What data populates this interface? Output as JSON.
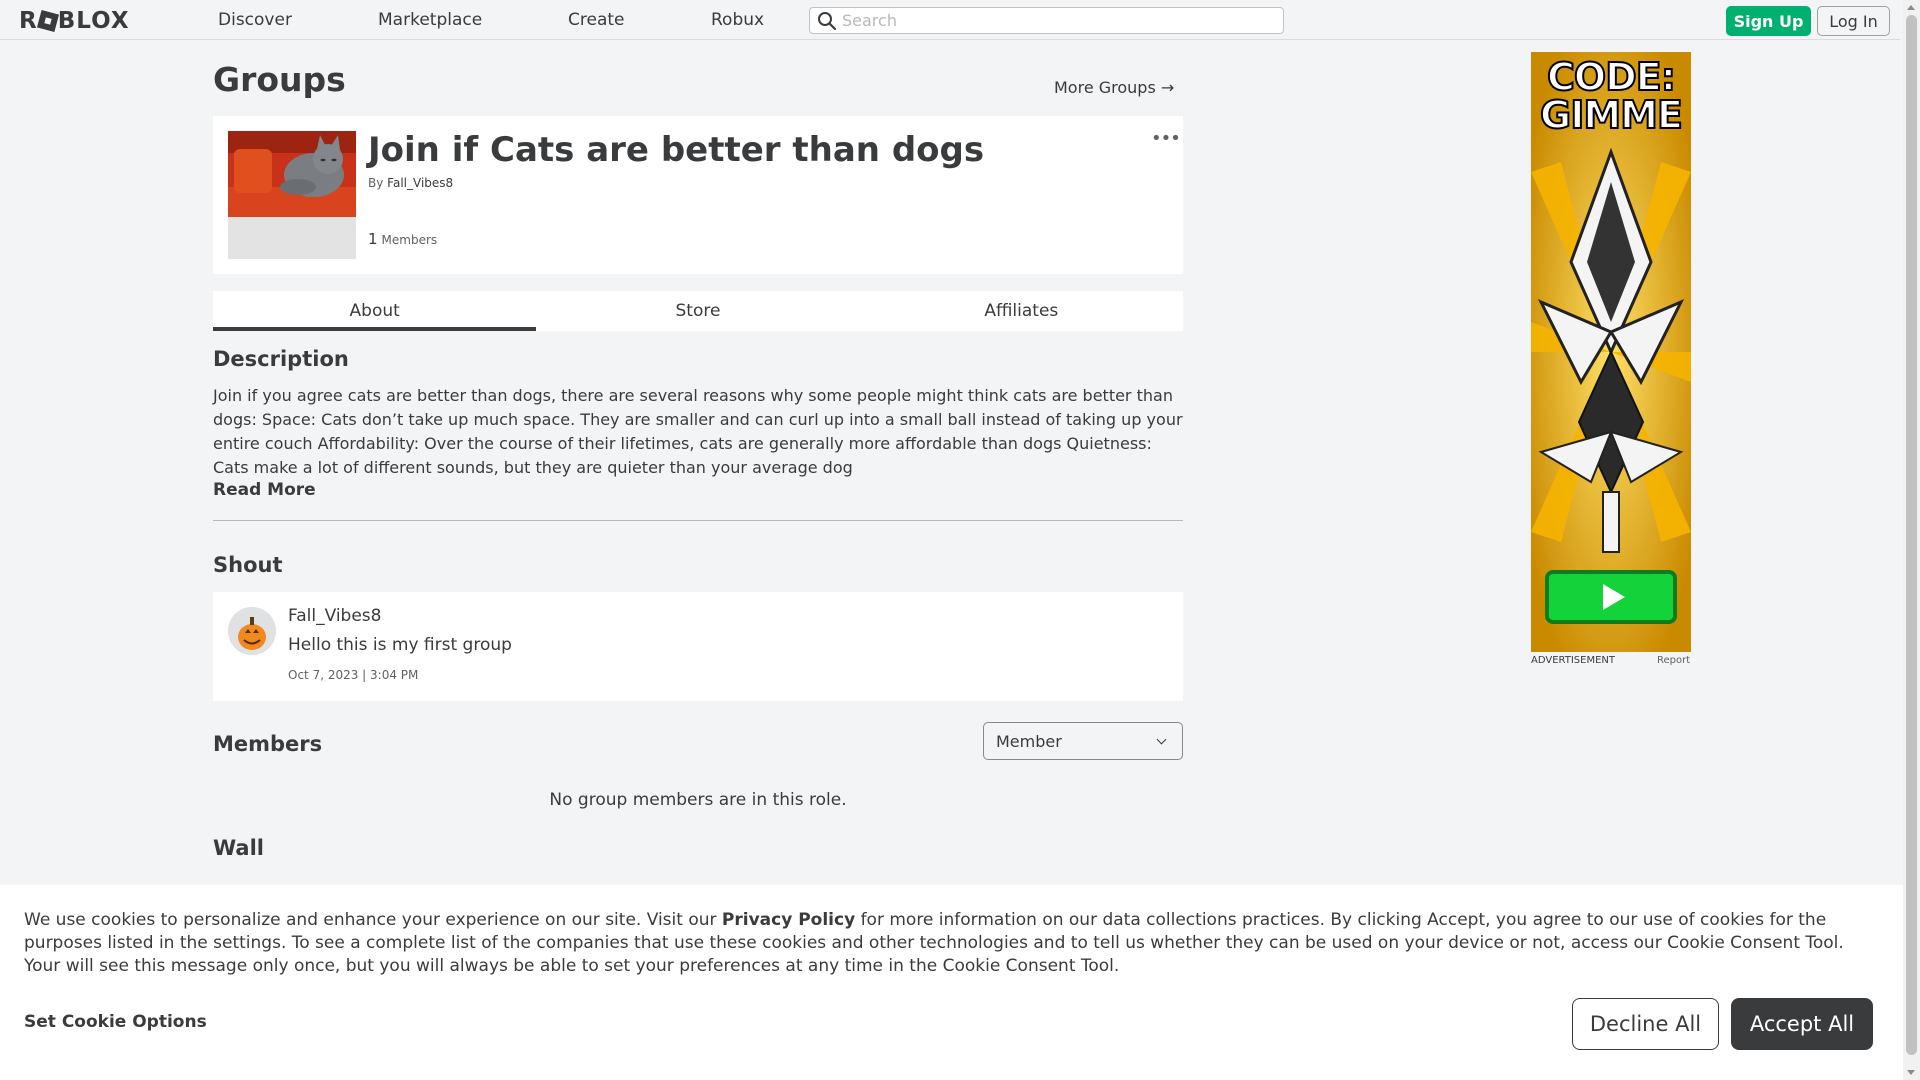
{
  "nav": {
    "logo_text": "ROBLOX",
    "links": [
      "Discover",
      "Marketplace",
      "Create",
      "Robux"
    ],
    "search_placeholder": "Search",
    "signup_label": "Sign Up",
    "login_label": "Log In"
  },
  "page": {
    "title": "Groups",
    "more_groups": "More Groups →"
  },
  "group": {
    "name": "Join if Cats are better than dogs",
    "by_label": "By",
    "owner": "Fall_Vibes8",
    "member_count": "1",
    "members_label": "Members",
    "menu_glyph": "•••"
  },
  "tabs": [
    "About",
    "Store",
    "Affiliates"
  ],
  "about": {
    "description_heading": "Description",
    "description": "Join if you agree cats are better than dogs, there are several reasons why some people might think cats are better than dogs: Space: Cats don’t take up much space. They are smaller and can curl up into a small ball instead of taking up your entire couch Affordability: Over the course of their lifetimes, cats are generally more affordable than dogs Quietness: Cats make a lot of different sounds, but they are quieter than your average dog",
    "read_more": "Read More",
    "shout_heading": "Shout",
    "shout": {
      "user": "Fall_Vibes8",
      "text": "Hello this is my first group",
      "date": "Oct 7, 2023 | 3:04 PM"
    },
    "members_heading": "Members",
    "role_selected": "Member",
    "empty_members": "No group members are in this role.",
    "wall_heading": "Wall"
  },
  "ad": {
    "headline_line1": "CODE:",
    "headline_line2": "GIMME",
    "label": "ADVERTISEMENT",
    "report": "Report"
  },
  "cookie": {
    "text_before": "We use cookies to personalize and enhance your experience on our site. Visit our ",
    "privacy_link": "Privacy Policy",
    "text_after": " for more information on our data collections practices. By clicking Accept, you agree to our use of cookies for the purposes listed in the settings. To see a complete list of the companies that use these cookies and other technologies and to tell us whether they can be used on your device or not, access our Cookie Consent Tool. Your will see this message only once, but you will always be able to set your preferences at any time in the Cookie Consent Tool.",
    "options_label": "Set Cookie Options",
    "decline_label": "Decline All",
    "accept_label": "Accept All"
  },
  "colors": {
    "brand_green": "#00b06f",
    "text_dark": "#393b3d",
    "page_bg": "#f2f4f5"
  }
}
